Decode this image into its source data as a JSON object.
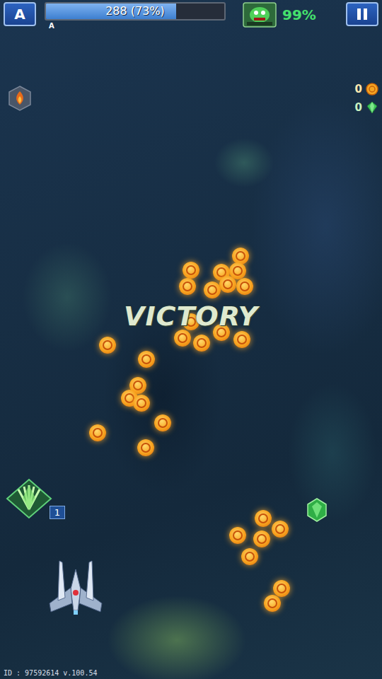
{
  "hud": {
    "menu_button": "A",
    "health": {
      "reading": "288 (73%)",
      "level": 0.73,
      "rank": "A"
    },
    "boss": {
      "reading": "99%"
    }
  },
  "counters": [
    {
      "value": "0",
      "kind": "coin"
    },
    {
      "value": "0",
      "kind": "gem"
    }
  ],
  "banner": "VICTORY",
  "skill": {
    "count": "1"
  },
  "footer": "ID : 97592614 v.100.54"
}
